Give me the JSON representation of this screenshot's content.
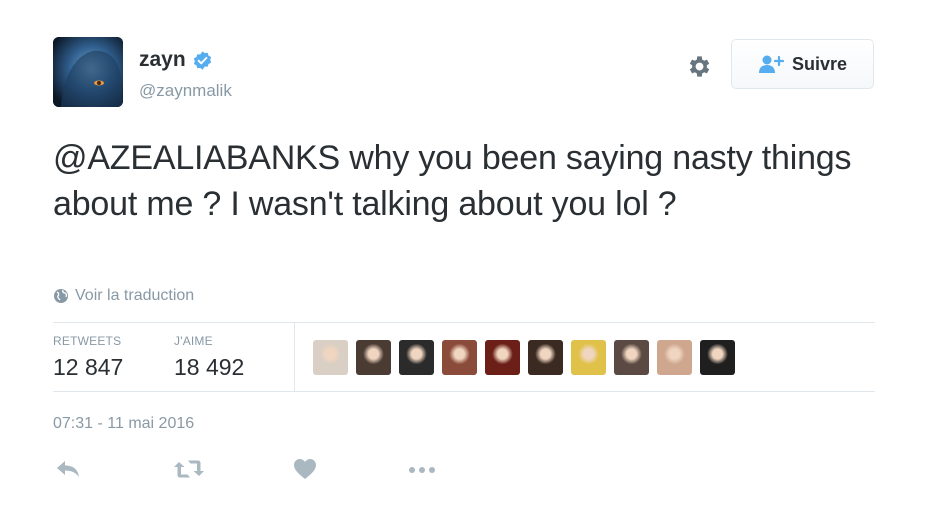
{
  "tweet": {
    "display_name": "zayn",
    "handle": "@zaynmalik",
    "mention": "@AZEALIABANKS",
    "text": " why you been saying nasty things about me ? I wasn't talking about you lol ?",
    "translate_label": "Voir la traduction",
    "timestamp": "07:31 - 11 mai 2016"
  },
  "follow_button": {
    "label": "Suivre"
  },
  "stats": [
    {
      "key": "RETWEETS",
      "value": "12 847"
    },
    {
      "key": "J'AIME",
      "value": "18 492"
    }
  ],
  "liker_avatars": [
    {
      "color": "#d9cfc4"
    },
    {
      "color": "#4a3b33"
    },
    {
      "color": "#2b2b2b"
    },
    {
      "color": "#8a4b3a"
    },
    {
      "color": "#6b1f17"
    },
    {
      "color": "#3a2a22"
    },
    {
      "color": "#e0c24a"
    },
    {
      "color": "#5b4a43"
    },
    {
      "color": "#cfa78f"
    },
    {
      "color": "#1f1f1f"
    }
  ],
  "actions": [
    "reply-icon",
    "retweet-icon",
    "like-icon",
    "more-icon"
  ],
  "colors": {
    "text": "#292f33",
    "muted": "#8899a6",
    "verified": "#55acee",
    "follow_icon": "#55acee",
    "divider": "#e1e8ed",
    "action_icon": "#aab8c2"
  }
}
